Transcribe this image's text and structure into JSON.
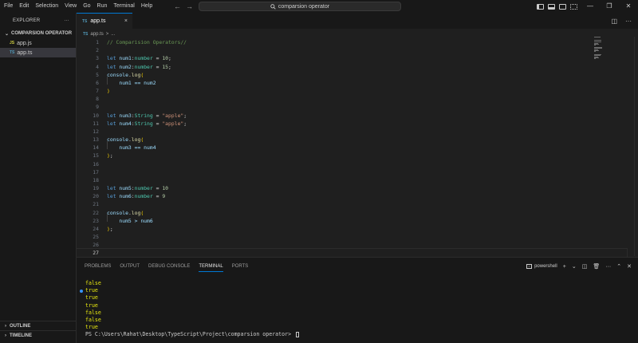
{
  "menu": [
    "File",
    "Edit",
    "Selection",
    "View",
    "Go",
    "Run",
    "Terminal",
    "Help"
  ],
  "command_center": {
    "text": "comparsion operator",
    "icon": "search-icon"
  },
  "window_controls": {
    "minimize": "—",
    "restore": "❐",
    "close": "✕"
  },
  "sidebar": {
    "header": "EXPLORER",
    "more": "···",
    "folder": "COMPARSION OPERATOR",
    "files": [
      {
        "badge": "JS",
        "name": "app.js"
      },
      {
        "badge": "TS",
        "name": "app.ts"
      }
    ],
    "outline": "OUTLINE",
    "timeline": "TIMELINE"
  },
  "tab": {
    "badge": "TS",
    "name": "app.ts",
    "close": "×"
  },
  "breadcrumb": {
    "badge": "TS",
    "file": "app.ts",
    "sep": ">",
    "rest": "..."
  },
  "editor": {
    "line_numbers": [
      "1",
      "2",
      "3",
      "4",
      "5",
      "6",
      "7",
      "8",
      "9",
      "10",
      "11",
      "12",
      "13",
      "14",
      "15",
      "16",
      "17",
      "18",
      "19",
      "20",
      "21",
      "22",
      "23",
      "24",
      "25",
      "26",
      "27"
    ],
    "lines": {
      "l1": "// Comparision Operators//",
      "l3a": "num1",
      "l3b": "number",
      "l3c": "10",
      "l4a": "num2",
      "l4b": "number",
      "l4c": "15",
      "l7": "num1 == num2",
      "l10a": "num3",
      "l10b": "String",
      "l10c": "\"apple\"",
      "l11a": "num4",
      "l11b": "String",
      "l11c": "\"apple\"",
      "l14": "num3 == num4",
      "l19a": "num5",
      "l19b": "number",
      "l19c": "10",
      "l20a": "num6",
      "l20b": "number",
      "l20c": "9",
      "l23": "num5 > num6"
    },
    "keyword_let": "let",
    "fn_console": "console",
    "fn_log": "log"
  },
  "panel": {
    "tabs": [
      "PROBLEMS",
      "OUTPUT",
      "DEBUG CONSOLE",
      "TERMINAL",
      "PORTS"
    ],
    "active_tab": "TERMINAL",
    "shell": "powershell",
    "output": [
      "false",
      "true",
      "true",
      "true",
      "false",
      "false",
      "true"
    ],
    "prompt": "PS C:\\Users\\Rahat\\Desktop\\TypeScript\\Project\\comparsion operator> "
  },
  "colors": {
    "accent": "#0078d4",
    "terminal_output": "#e5e510"
  }
}
